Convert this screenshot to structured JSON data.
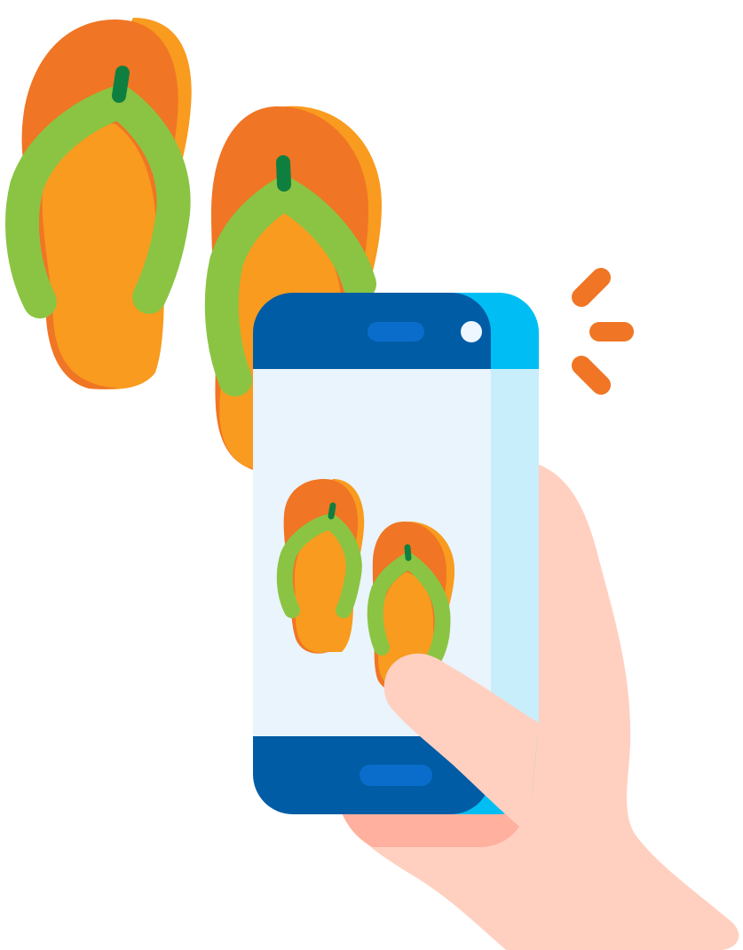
{
  "illustration": {
    "subject": "phone-photo-of-flip-flops",
    "colors": {
      "sandal_top": "#F07524",
      "sandal_body": "#F99B1E",
      "strap": "#8BC443",
      "strap_peg": "#0F7F3F",
      "phone_frame": "#005CA5",
      "phone_edge": "#00BEF3",
      "screen": "#E9F4FC",
      "screen_side": "#C8EEFB",
      "button": "#0A6DCB",
      "camera": "#EEF6FF",
      "skin": "#FFD0C0",
      "skin_shadow": "#FFB09E",
      "sparkle": "#F07524"
    },
    "icons": [
      "flip-flop-icon",
      "flip-flop-icon",
      "smartphone-icon",
      "hand-icon",
      "sparkle-icon"
    ]
  }
}
